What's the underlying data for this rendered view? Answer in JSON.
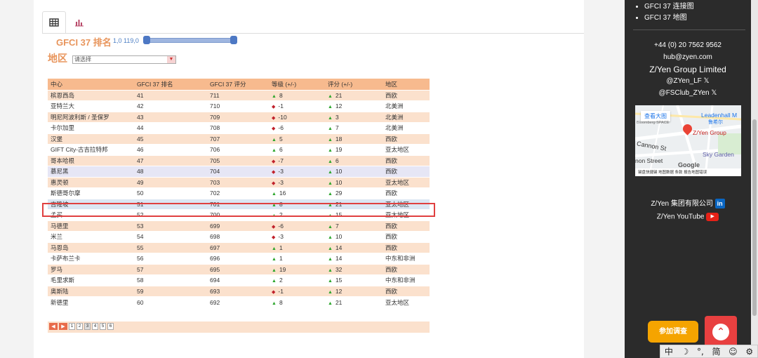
{
  "tabs": {
    "table_icon": "table-icon",
    "chart_icon": "bar-chart-icon"
  },
  "filters": {
    "rank_label": "GFCI 37 排名",
    "rank_range_text": "1,0 119,0",
    "region_label": "地区",
    "region_placeholder": "请选择"
  },
  "table": {
    "headers": [
      "中心",
      "GFCI 37 排名",
      "GFCI 37 评分",
      "等级 (+/-)",
      "评分 (+/-)",
      "地区"
    ],
    "rows": [
      {
        "center": "槟恩西岛",
        "rank": "41",
        "score": "711",
        "rank_dir": "up",
        "rank_change": "8",
        "score_dir": "up",
        "score_change": "21",
        "region": "西欧"
      },
      {
        "center": "亚特兰大",
        "rank": "42",
        "score": "710",
        "rank_dir": "down",
        "rank_change": "-1",
        "score_dir": "up",
        "score_change": "12",
        "region": "北美洲"
      },
      {
        "center": "明尼阿波利斯 / 圣保罗",
        "rank": "43",
        "score": "709",
        "rank_dir": "down",
        "rank_change": "-10",
        "score_dir": "up",
        "score_change": "3",
        "region": "北美洲"
      },
      {
        "center": "卡尔加里",
        "rank": "44",
        "score": "708",
        "rank_dir": "down",
        "rank_change": "-6",
        "score_dir": "up",
        "score_change": "7",
        "region": "北美洲"
      },
      {
        "center": "汉堡",
        "rank": "45",
        "score": "707",
        "rank_dir": "up",
        "rank_change": "5",
        "score_dir": "up",
        "score_change": "18",
        "region": "西欧"
      },
      {
        "center": "GIFT City-古吉拉特邦",
        "rank": "46",
        "score": "706",
        "rank_dir": "up",
        "rank_change": "6",
        "score_dir": "up",
        "score_change": "19",
        "region": "亚太地区"
      },
      {
        "center": "哥本哈根",
        "rank": "47",
        "score": "705",
        "rank_dir": "down",
        "rank_change": "-7",
        "score_dir": "up",
        "score_change": "6",
        "region": "西欧"
      },
      {
        "center": "慕尼黑",
        "rank": "48",
        "score": "704",
        "rank_dir": "down",
        "rank_change": "-3",
        "score_dir": "up",
        "score_change": "10",
        "region": "西欧"
      },
      {
        "center": "惠灵顿",
        "rank": "49",
        "score": "703",
        "rank_dir": "down",
        "rank_change": "-3",
        "score_dir": "up",
        "score_change": "10",
        "region": "亚太地区"
      },
      {
        "center": "斯德哥尔摩",
        "rank": "50",
        "score": "702",
        "rank_dir": "up",
        "rank_change": "16",
        "score_dir": "up",
        "score_change": "29",
        "region": "西欧"
      },
      {
        "center": "吉隆坡",
        "rank": "51",
        "score": "701",
        "rank_dir": "up",
        "rank_change": "8",
        "score_dir": "up",
        "score_change": "21",
        "region": "亚太地区"
      },
      {
        "center": "孟买",
        "rank": "52",
        "score": "700",
        "rank_dir": "up",
        "rank_change": "2",
        "score_dir": "up",
        "score_change": "15",
        "region": "亚太地区"
      },
      {
        "center": "马德里",
        "rank": "53",
        "score": "699",
        "rank_dir": "down",
        "rank_change": "-6",
        "score_dir": "up",
        "score_change": "7",
        "region": "西欧"
      },
      {
        "center": "米兰",
        "rank": "54",
        "score": "698",
        "rank_dir": "down",
        "rank_change": "-3",
        "score_dir": "up",
        "score_change": "10",
        "region": "西欧"
      },
      {
        "center": "马恩岛",
        "rank": "55",
        "score": "697",
        "rank_dir": "up",
        "rank_change": "1",
        "score_dir": "up",
        "score_change": "14",
        "region": "西欧"
      },
      {
        "center": "卡萨布兰卡",
        "rank": "56",
        "score": "696",
        "rank_dir": "up",
        "rank_change": "1",
        "score_dir": "up",
        "score_change": "14",
        "region": "中东和非洲"
      },
      {
        "center": "罗马",
        "rank": "57",
        "score": "695",
        "rank_dir": "up",
        "rank_change": "19",
        "score_dir": "up",
        "score_change": "32",
        "region": "西欧"
      },
      {
        "center": "毛里求斯",
        "rank": "58",
        "score": "694",
        "rank_dir": "up",
        "rank_change": "2",
        "score_dir": "up",
        "score_change": "15",
        "region": "中东和非洲"
      },
      {
        "center": "奥斯陆",
        "rank": "59",
        "score": "693",
        "rank_dir": "down",
        "rank_change": "-1",
        "score_dir": "up",
        "score_change": "12",
        "region": "西欧"
      },
      {
        "center": "新德里",
        "rank": "60",
        "score": "692",
        "rank_dir": "up",
        "rank_change": "8",
        "score_dir": "up",
        "score_change": "21",
        "region": "亚太地区"
      }
    ],
    "highlighted_row": 10
  },
  "pager": {
    "pages": [
      "1",
      "2",
      "3",
      "4",
      "5",
      "6"
    ],
    "current": "3"
  },
  "sidebar": {
    "links": [
      "GFCI 37 连接图",
      "GFCI 37 地图"
    ],
    "phone": "+44 (0) 20 7562 9562",
    "email": "hub@zyen.com",
    "company": "Z/Yen Group Limited",
    "twitter1": "@ZYen_LF",
    "twitter2": "@FSClub_ZYen",
    "map": {
      "view_larger": "查看大图",
      "leadenhall": "Leadenhall M",
      "leadenhall_sub": "鲁希尔",
      "bloomberg": "Bloomberg SPACE",
      "zyen_pin": "Z/Yen Group",
      "cannon_st": "Cannon St",
      "cannon_street": "non Street",
      "sky_garden": "Sky Garden",
      "google": "Google",
      "footer": "键盘快捷键  地图数据  条款  报告地图错误"
    },
    "linkedin_label": "Z/Yen 集团有限公司",
    "youtube_label": "Z/Yen YouTube"
  },
  "join_button": "参加调查",
  "ime_bar": [
    "中",
    "☽",
    "°,",
    "简",
    "☺",
    "⚙"
  ],
  "colors": {
    "accent": "#e8955c",
    "header": "#f7ba8e",
    "row_alt": "#fbe1cd",
    "highlight_border": "#e04040"
  }
}
